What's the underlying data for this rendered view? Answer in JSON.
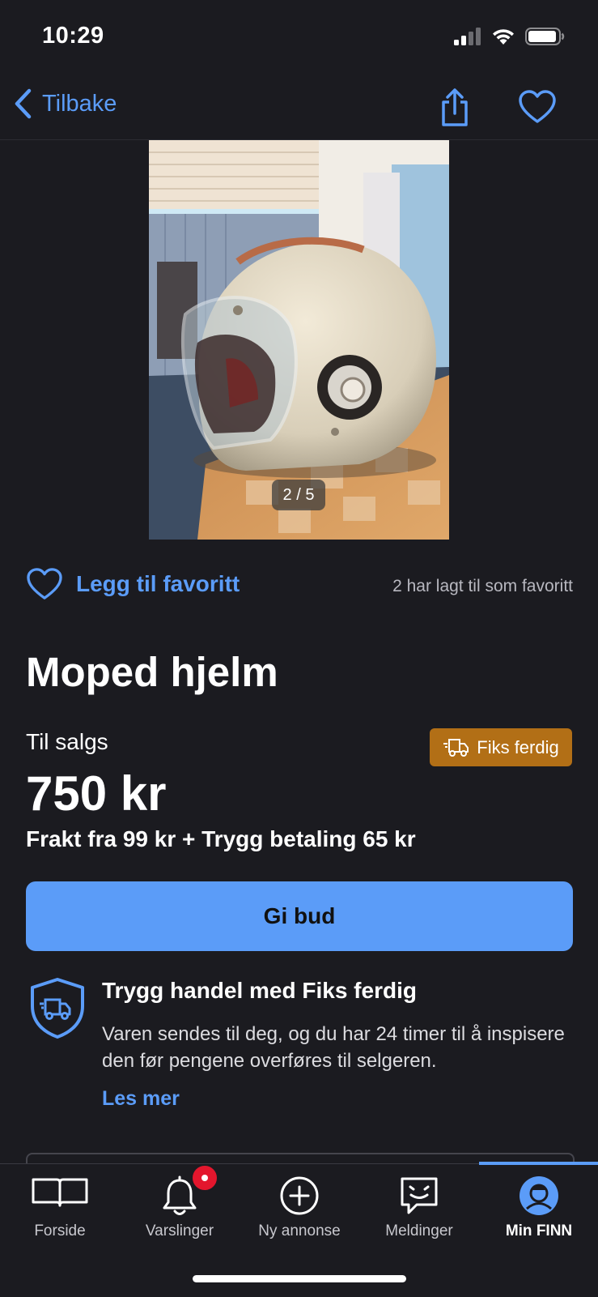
{
  "status": {
    "time": "10:29"
  },
  "nav": {
    "back_label": "Tilbake"
  },
  "photo": {
    "counter": "2 / 5"
  },
  "favorite": {
    "add_label": "Legg til favoritt",
    "count_text": "2 har lagt til som favoritt"
  },
  "listing": {
    "title": "Moped hjelm",
    "sale_type": "Til salgs",
    "badge": "Fiks ferdig",
    "price": "750 kr",
    "shipping": "Frakt fra 99 kr + Trygg betaling 65 kr",
    "bid_label": "Gi bud"
  },
  "trygg": {
    "title": "Trygg handel med Fiks ferdig",
    "text": "Varen sendes til deg, og du har 24 timer til å inspisere den før pengene overføres til selgeren.",
    "link": "Les mer"
  },
  "tabs": [
    {
      "label": "Forside",
      "icon": "book-icon"
    },
    {
      "label": "Varslinger",
      "icon": "bell-icon"
    },
    {
      "label": "Ny annonse",
      "icon": "plus-circle-icon"
    },
    {
      "label": "Meldinger",
      "icon": "chat-icon"
    },
    {
      "label": "Min FINN",
      "icon": "profile-icon",
      "active": true
    }
  ],
  "colors": {
    "accent": "#5b9cf8",
    "background": "#1b1b20",
    "badge": "#b26f16",
    "notification": "#e3162d"
  }
}
